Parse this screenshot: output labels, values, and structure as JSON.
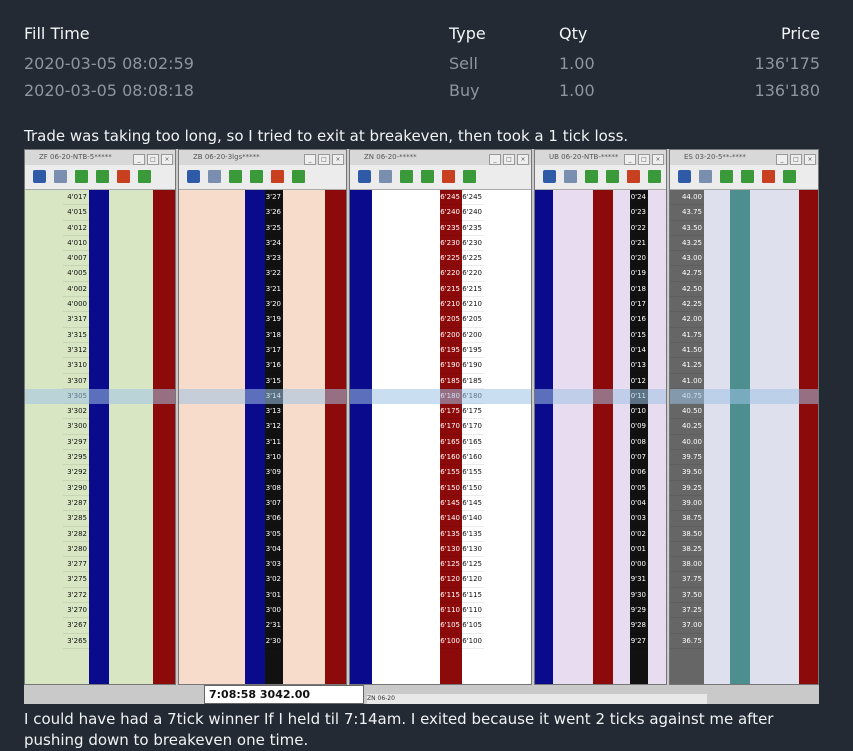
{
  "fills_table": {
    "headers": {
      "time": "Fill Time",
      "type": "Type",
      "qty": "Qty",
      "price": "Price"
    },
    "rows": [
      {
        "time": "2020-03-05 08:02:59",
        "type": "Sell",
        "qty": "1.00",
        "price": "136'175"
      },
      {
        "time": "2020-03-05 08:08:18",
        "type": "Buy",
        "qty": "1.00",
        "price": "136'180"
      }
    ]
  },
  "caption_top": "Trade was taking too long, so I tried to exit at breakeven, then took a 1 tick loss.",
  "caption_bottom": "I could have had a 7tick winner If I held til 7:14am. I exited because it went 2 ticks against me after pushing down to breakeven one time.",
  "screenshot": {
    "panels": [
      {
        "title": "ZF 06-20-NTB-5*****",
        "prices": [
          "4'017",
          "4'015",
          "4'012",
          "4'010",
          "4'007",
          "4'005",
          "4'002",
          "4'000",
          "3'317",
          "3'315",
          "3'312",
          "3'310",
          "3'307",
          "3'305",
          "3'302",
          "3'300",
          "3'297",
          "3'295",
          "3'292",
          "3'290",
          "3'287",
          "3'285",
          "3'282",
          "3'280",
          "3'277",
          "3'275",
          "3'272",
          "3'270",
          "3'267",
          "3'265"
        ]
      },
      {
        "title": "ZB 06-20-3lgs*****",
        "prices": [
          "3'27",
          "3'26",
          "3'25",
          "3'24",
          "3'23",
          "3'22",
          "3'21",
          "3'20",
          "3'19",
          "3'18",
          "3'17",
          "3'16",
          "3'15",
          "3'14",
          "3'13",
          "3'12",
          "3'11",
          "3'10",
          "3'09",
          "3'08",
          "3'07",
          "3'06",
          "3'05",
          "3'04",
          "3'03",
          "3'02",
          "3'01",
          "3'00",
          "2'31",
          "2'30"
        ]
      },
      {
        "title": "ZN 06-20-*****",
        "prices": [
          "6'245",
          "6'240",
          "6'235",
          "6'230",
          "6'225",
          "6'220",
          "6'215",
          "6'210",
          "6'205",
          "6'200",
          "6'195",
          "6'190",
          "6'185",
          "6'180",
          "6'175",
          "6'170",
          "6'165",
          "6'160",
          "6'155",
          "6'150",
          "6'145",
          "6'140",
          "6'135",
          "6'130",
          "6'125",
          "6'120",
          "6'115",
          "6'110",
          "6'105",
          "6'100"
        ]
      },
      {
        "title": "UB 06-20-NTB-*****",
        "prices": [
          "0'24",
          "0'23",
          "0'22",
          "0'21",
          "0'20",
          "0'19",
          "0'18",
          "0'17",
          "0'16",
          "0'15",
          "0'14",
          "0'13",
          "0'12",
          "0'11",
          "0'10",
          "0'09",
          "0'08",
          "0'07",
          "0'06",
          "0'05",
          "0'04",
          "0'03",
          "0'02",
          "0'01",
          "0'00",
          "9'31",
          "9'30",
          "9'29",
          "9'28",
          "9'27"
        ]
      },
      {
        "title": "ES 03-20-5**-****",
        "prices": [
          "44.00",
          "43.75",
          "43.50",
          "43.25",
          "43.00",
          "42.75",
          "42.50",
          "42.25",
          "42.00",
          "41.75",
          "41.50",
          "41.25",
          "41.00",
          "40.75",
          "40.50",
          "40.25",
          "40.00",
          "39.75",
          "39.50",
          "39.25",
          "39.00",
          "38.75",
          "38.50",
          "38.25",
          "38.00",
          "37.75",
          "37.50",
          "37.25",
          "37.00",
          "36.75"
        ]
      }
    ],
    "time_readout": "7:08:58 3042.00",
    "order_bar": "ZN 06-20",
    "colors": {
      "zf_bg": "#d9e6c3",
      "zb_bg": "#f7dccb",
      "zn_bg": "#ffffff",
      "ub_bg": "#e8dcf0",
      "es_bg": "#dfe0ee",
      "navy": "#0a0a8c",
      "maroon": "#8c0a0a",
      "teal": "#4d8f8f",
      "highlight": "#9fc3e6"
    }
  }
}
